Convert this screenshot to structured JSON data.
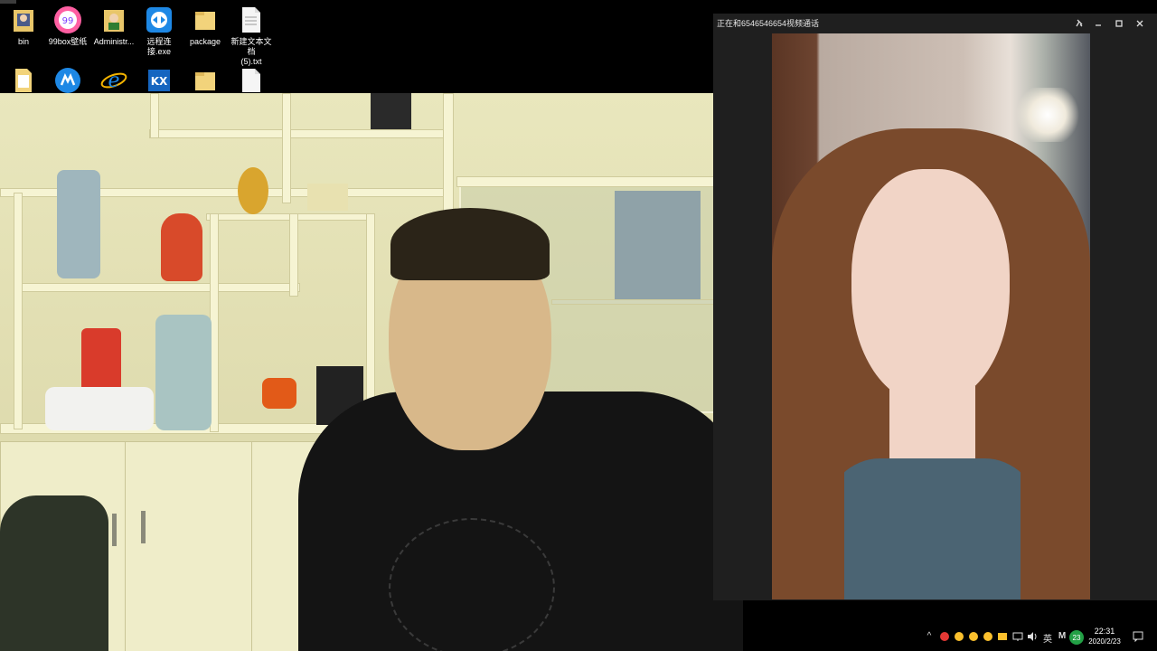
{
  "desktop": {
    "icons_row1": [
      {
        "label": "bin",
        "icon": "folder-user-icon"
      },
      {
        "label": "99box壁纸",
        "icon": "app-99box-icon"
      },
      {
        "label": "Administr...",
        "icon": "user-folder-icon"
      },
      {
        "label": "远程连接.exe",
        "icon": "teamviewer-icon"
      },
      {
        "label": "package",
        "icon": "folder-icon"
      },
      {
        "label": "新建文本文档\n(5).txt",
        "icon": "text-file-icon"
      }
    ],
    "icons_row2": [
      {
        "label": "",
        "icon": "file-icon"
      },
      {
        "label": "",
        "icon": "app-blue-icon"
      },
      {
        "label": "",
        "icon": "ie-icon"
      },
      {
        "label": "",
        "icon": "app-kx-icon"
      },
      {
        "label": "",
        "icon": "folder-icon"
      },
      {
        "label": "",
        "icon": "file-icon"
      }
    ]
  },
  "call_window": {
    "title": "正在和6546546654视频通话",
    "pin_icon": "pin-icon",
    "minimize_icon": "minimize-icon",
    "maximize_icon": "maximize-icon",
    "close_icon": "close-icon"
  },
  "taskbar": {
    "ime_label": "英",
    "m_label": "M",
    "badge_count": "23",
    "time": "22:31",
    "date": "2020/2/23"
  },
  "colors": {
    "accent_green": "#22a045",
    "titlebar": "#1f1f1f",
    "taskbar": "#000000"
  }
}
